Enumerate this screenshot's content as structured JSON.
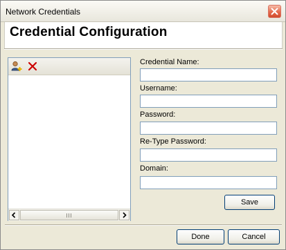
{
  "window": {
    "title": "Network Credentials"
  },
  "header": {
    "title": "Credential Configuration"
  },
  "list_toolbar": {
    "add_icon": "user-add-icon",
    "delete_icon": "delete-x-icon",
    "delete_color": "#cc0000"
  },
  "list": {
    "items": []
  },
  "form": {
    "credential_name": {
      "label": "Credential Name:",
      "value": ""
    },
    "username": {
      "label": "Username:",
      "value": ""
    },
    "password": {
      "label": "Password:",
      "value": ""
    },
    "retype_password": {
      "label": "Re-Type Password:",
      "value": ""
    },
    "domain": {
      "label": "Domain:",
      "value": ""
    },
    "save_label": "Save"
  },
  "footer": {
    "done_label": "Done",
    "cancel_label": "Cancel"
  },
  "colors": {
    "close_button": "#e56a4c",
    "input_border": "#7f9db9",
    "button_border": "#003c74"
  }
}
